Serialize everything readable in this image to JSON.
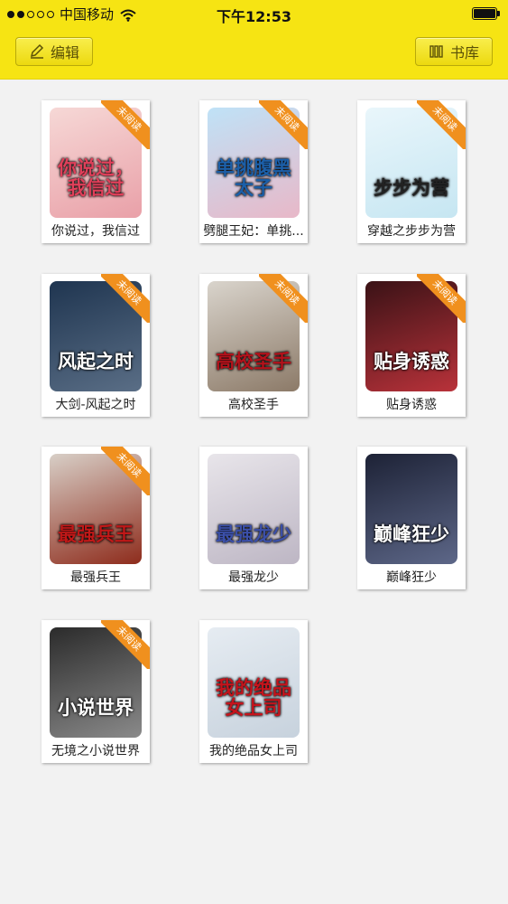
{
  "status_bar": {
    "carrier": "中国移动",
    "time": "下午12:53",
    "signal_dots_filled": 2,
    "signal_dots_total": 5
  },
  "nav": {
    "edit_label": "编辑",
    "library_label": "书库"
  },
  "badge_label": "未阅读",
  "books": [
    {
      "title": "你说过，我信过",
      "cover_text": "你说过，\n我信过",
      "unread": true,
      "colors": [
        "#f6d8d6",
        "#e9a0a8"
      ],
      "text_color": "#e0405a"
    },
    {
      "title": "劈腿王妃：单挑...",
      "cover_text": "单挑腹黑太子",
      "unread": true,
      "colors": [
        "#bfe2f7",
        "#e8b8c8"
      ],
      "text_color": "#1c5fa8"
    },
    {
      "title": "穿越之步步为营",
      "cover_text": "步步为营",
      "unread": true,
      "colors": [
        "#e9f6fb",
        "#c6e6f2"
      ],
      "text_color": "#222222"
    },
    {
      "title": "大剑-风起之时",
      "cover_text": "风起之时",
      "unread": true,
      "colors": [
        "#1f3550",
        "#5a6e86"
      ],
      "text_color": "#ffffff"
    },
    {
      "title": "高校圣手",
      "cover_text": "高校圣手",
      "unread": true,
      "colors": [
        "#d9d4cc",
        "#8c7a68"
      ],
      "text_color": "#b3121b"
    },
    {
      "title": "贴身诱惑",
      "cover_text": "贴身诱惑",
      "unread": true,
      "colors": [
        "#3a1216",
        "#b9323a"
      ],
      "text_color": "#ffffff"
    },
    {
      "title": "最强兵王",
      "cover_text": "最强兵王",
      "unread": true,
      "colors": [
        "#d8cfc7",
        "#8e2c1c"
      ],
      "text_color": "#c01818"
    },
    {
      "title": "最强龙少",
      "cover_text": "最强龙少",
      "unread": false,
      "colors": [
        "#e8e5ea",
        "#bdb6c4"
      ],
      "text_color": "#3b4fa8"
    },
    {
      "title": "巅峰狂少",
      "cover_text": "巅峰狂少",
      "unread": false,
      "colors": [
        "#1d2236",
        "#5d6788"
      ],
      "text_color": "#ffffff"
    },
    {
      "title": "无境之小说世界",
      "cover_text": "小说世界",
      "unread": true,
      "colors": [
        "#2b2b2b",
        "#8a8a8a"
      ],
      "text_color": "#ffffff"
    },
    {
      "title": "我的绝品女上司",
      "cover_text": "我的绝品\n女上司",
      "unread": false,
      "colors": [
        "#e6ecf2",
        "#c7d2dd"
      ],
      "text_color": "#c4141c"
    }
  ]
}
